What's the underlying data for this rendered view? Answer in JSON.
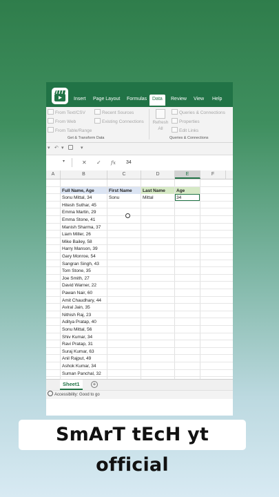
{
  "ribbon": {
    "tabs": [
      "Insert",
      "Page Layout",
      "Formulas",
      "Data",
      "Review",
      "View",
      "Help"
    ],
    "active_tab": "Data",
    "get_transform": {
      "items": [
        "From Text/CSV",
        "From Web",
        "From Table/Range",
        "Recent Sources",
        "Existing Connections"
      ],
      "group_label": "Get & Transform Data"
    },
    "queries": {
      "refresh_label": "Refresh All",
      "items": [
        "Queries & Connections",
        "Properties",
        "Edit Links"
      ],
      "group_label": "Queries & Connections"
    }
  },
  "formula_bar": {
    "fx_label": "fx",
    "value": "34"
  },
  "columns": [
    "A",
    "B",
    "C",
    "D",
    "E",
    "F"
  ],
  "selected_column": "E",
  "table": {
    "headers": [
      "Full Name, Age",
      "First Name",
      "Last Name",
      "Age"
    ],
    "first_row": {
      "first": "Sonu",
      "last": "Mittal",
      "age": "34"
    },
    "names": [
      "Sonu Mittal, 34",
      "Hitesh Suthar, 45",
      "Emma Martin, 29",
      "Emma Stone, 41",
      "Manish Sharma, 37",
      "Liam Miller, 26",
      "Mike Bailey, 58",
      "Harry Manson, 39",
      "Gary Monroe, 54",
      "Sangran Singh, 43",
      "Tom Stone, 35",
      "Joe Smith, 27",
      "David Warner, 22",
      "Pawan Nair, 60",
      "Amit Chaudhary, 44",
      "Aviral Jain, 35",
      "Nithish Raj, 23",
      "Aditya Pratap, 40",
      "Sonu Mittal, 56",
      "Shiv Kumar, 34",
      "Ravi Pratap, 31",
      "Suraj Kumar, 63",
      "Anil Rajput, 49",
      "Ashok Kumar, 34",
      "Suman Panchal, 32"
    ]
  },
  "sheet_tab": "Sheet1",
  "status": "Accessibility: Good to go",
  "banner": "SmArT tEcH yt official",
  "colors": {
    "excel_green": "#217346",
    "header_blue": "#dbe4f3",
    "header_green": "#d6e9c6"
  }
}
